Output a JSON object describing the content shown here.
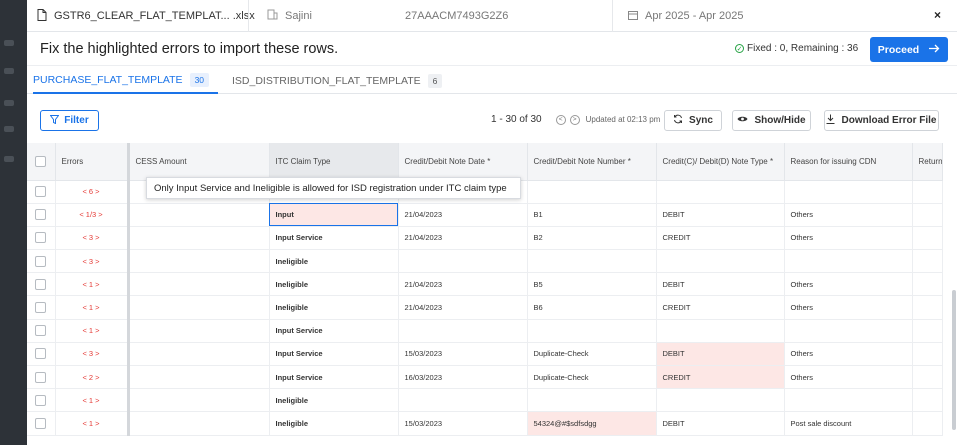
{
  "topbar": {
    "file_name": "GSTR6_CLEAR_FLAT_TEMPLAT... .xlsx",
    "user": "Sajini",
    "gstin": "27AAACM7493G2Z6",
    "period": "Apr 2025 - Apr 2025",
    "close": "×"
  },
  "header": {
    "title": "Fix the highlighted errors to import these rows.",
    "status": "Fixed : 0, Remaining : 36",
    "proceed": "Proceed"
  },
  "tabs": [
    {
      "label": "PURCHASE_FLAT_TEMPLATE",
      "count": "30"
    },
    {
      "label": "ISD_DISTRIBUTION_FLAT_TEMPLATE",
      "count": "6"
    }
  ],
  "toolbar": {
    "filter": "Filter",
    "range": "1 - 30 of 30",
    "updated": "Updated at 02:13 pm",
    "sync": "Sync",
    "show_hide": "Show/Hide",
    "download": "Download Error File"
  },
  "columns": [
    "",
    "Errors",
    "CESS Amount",
    "ITC Claim Type",
    "Credit/Debit Note Date *",
    "Credit/Debit Note Number *",
    "Credit(C)/ Debit(D) Note Type *",
    "Reason for issuing CDN",
    "Return Fi"
  ],
  "tooltip": "Only Input Service and Ineligible is allowed for ISD registration under ITC claim type",
  "rows": [
    [
      "< 6 >",
      "",
      "",
      "",
      "",
      "",
      ""
    ],
    [
      "< 1/3 >",
      "",
      "Input",
      "21/04/2023",
      "B1",
      "DEBIT",
      "Others"
    ],
    [
      "< 3 >",
      "",
      "Input Service",
      "21/04/2023",
      "B2",
      "CREDIT",
      "Others"
    ],
    [
      "< 3 >",
      "",
      "Ineligible",
      "",
      "",
      "",
      ""
    ],
    [
      "< 1 >",
      "",
      "Ineligible",
      "21/04/2023",
      "B5",
      "DEBIT",
      "Others"
    ],
    [
      "< 1 >",
      "",
      "Ineligible",
      "21/04/2023",
      "B6",
      "CREDIT",
      "Others"
    ],
    [
      "< 1 >",
      "",
      "Input Service",
      "",
      "",
      "",
      ""
    ],
    [
      "< 3 >",
      "",
      "Input Service",
      "15/03/2023",
      "Duplicate-Check",
      "DEBIT",
      "Others"
    ],
    [
      "< 2 >",
      "",
      "Input Service",
      "16/03/2023",
      "Duplicate-Check",
      "CREDIT",
      "Others"
    ],
    [
      "< 1 >",
      "",
      "Ineligible",
      "",
      "",
      "",
      ""
    ],
    [
      "< 1 >",
      "",
      "Ineligible",
      "15/03/2023",
      "54324@#$sdfsdgg",
      "DEBIT",
      "Post sale discount"
    ]
  ],
  "highlights": {
    "1": [
      2
    ],
    "7": [
      5
    ],
    "8": [
      5
    ],
    "10": [
      4
    ]
  },
  "colors": {
    "accent": "#1a73e8",
    "error": "#e53935",
    "highlight": "#fde7e5"
  }
}
